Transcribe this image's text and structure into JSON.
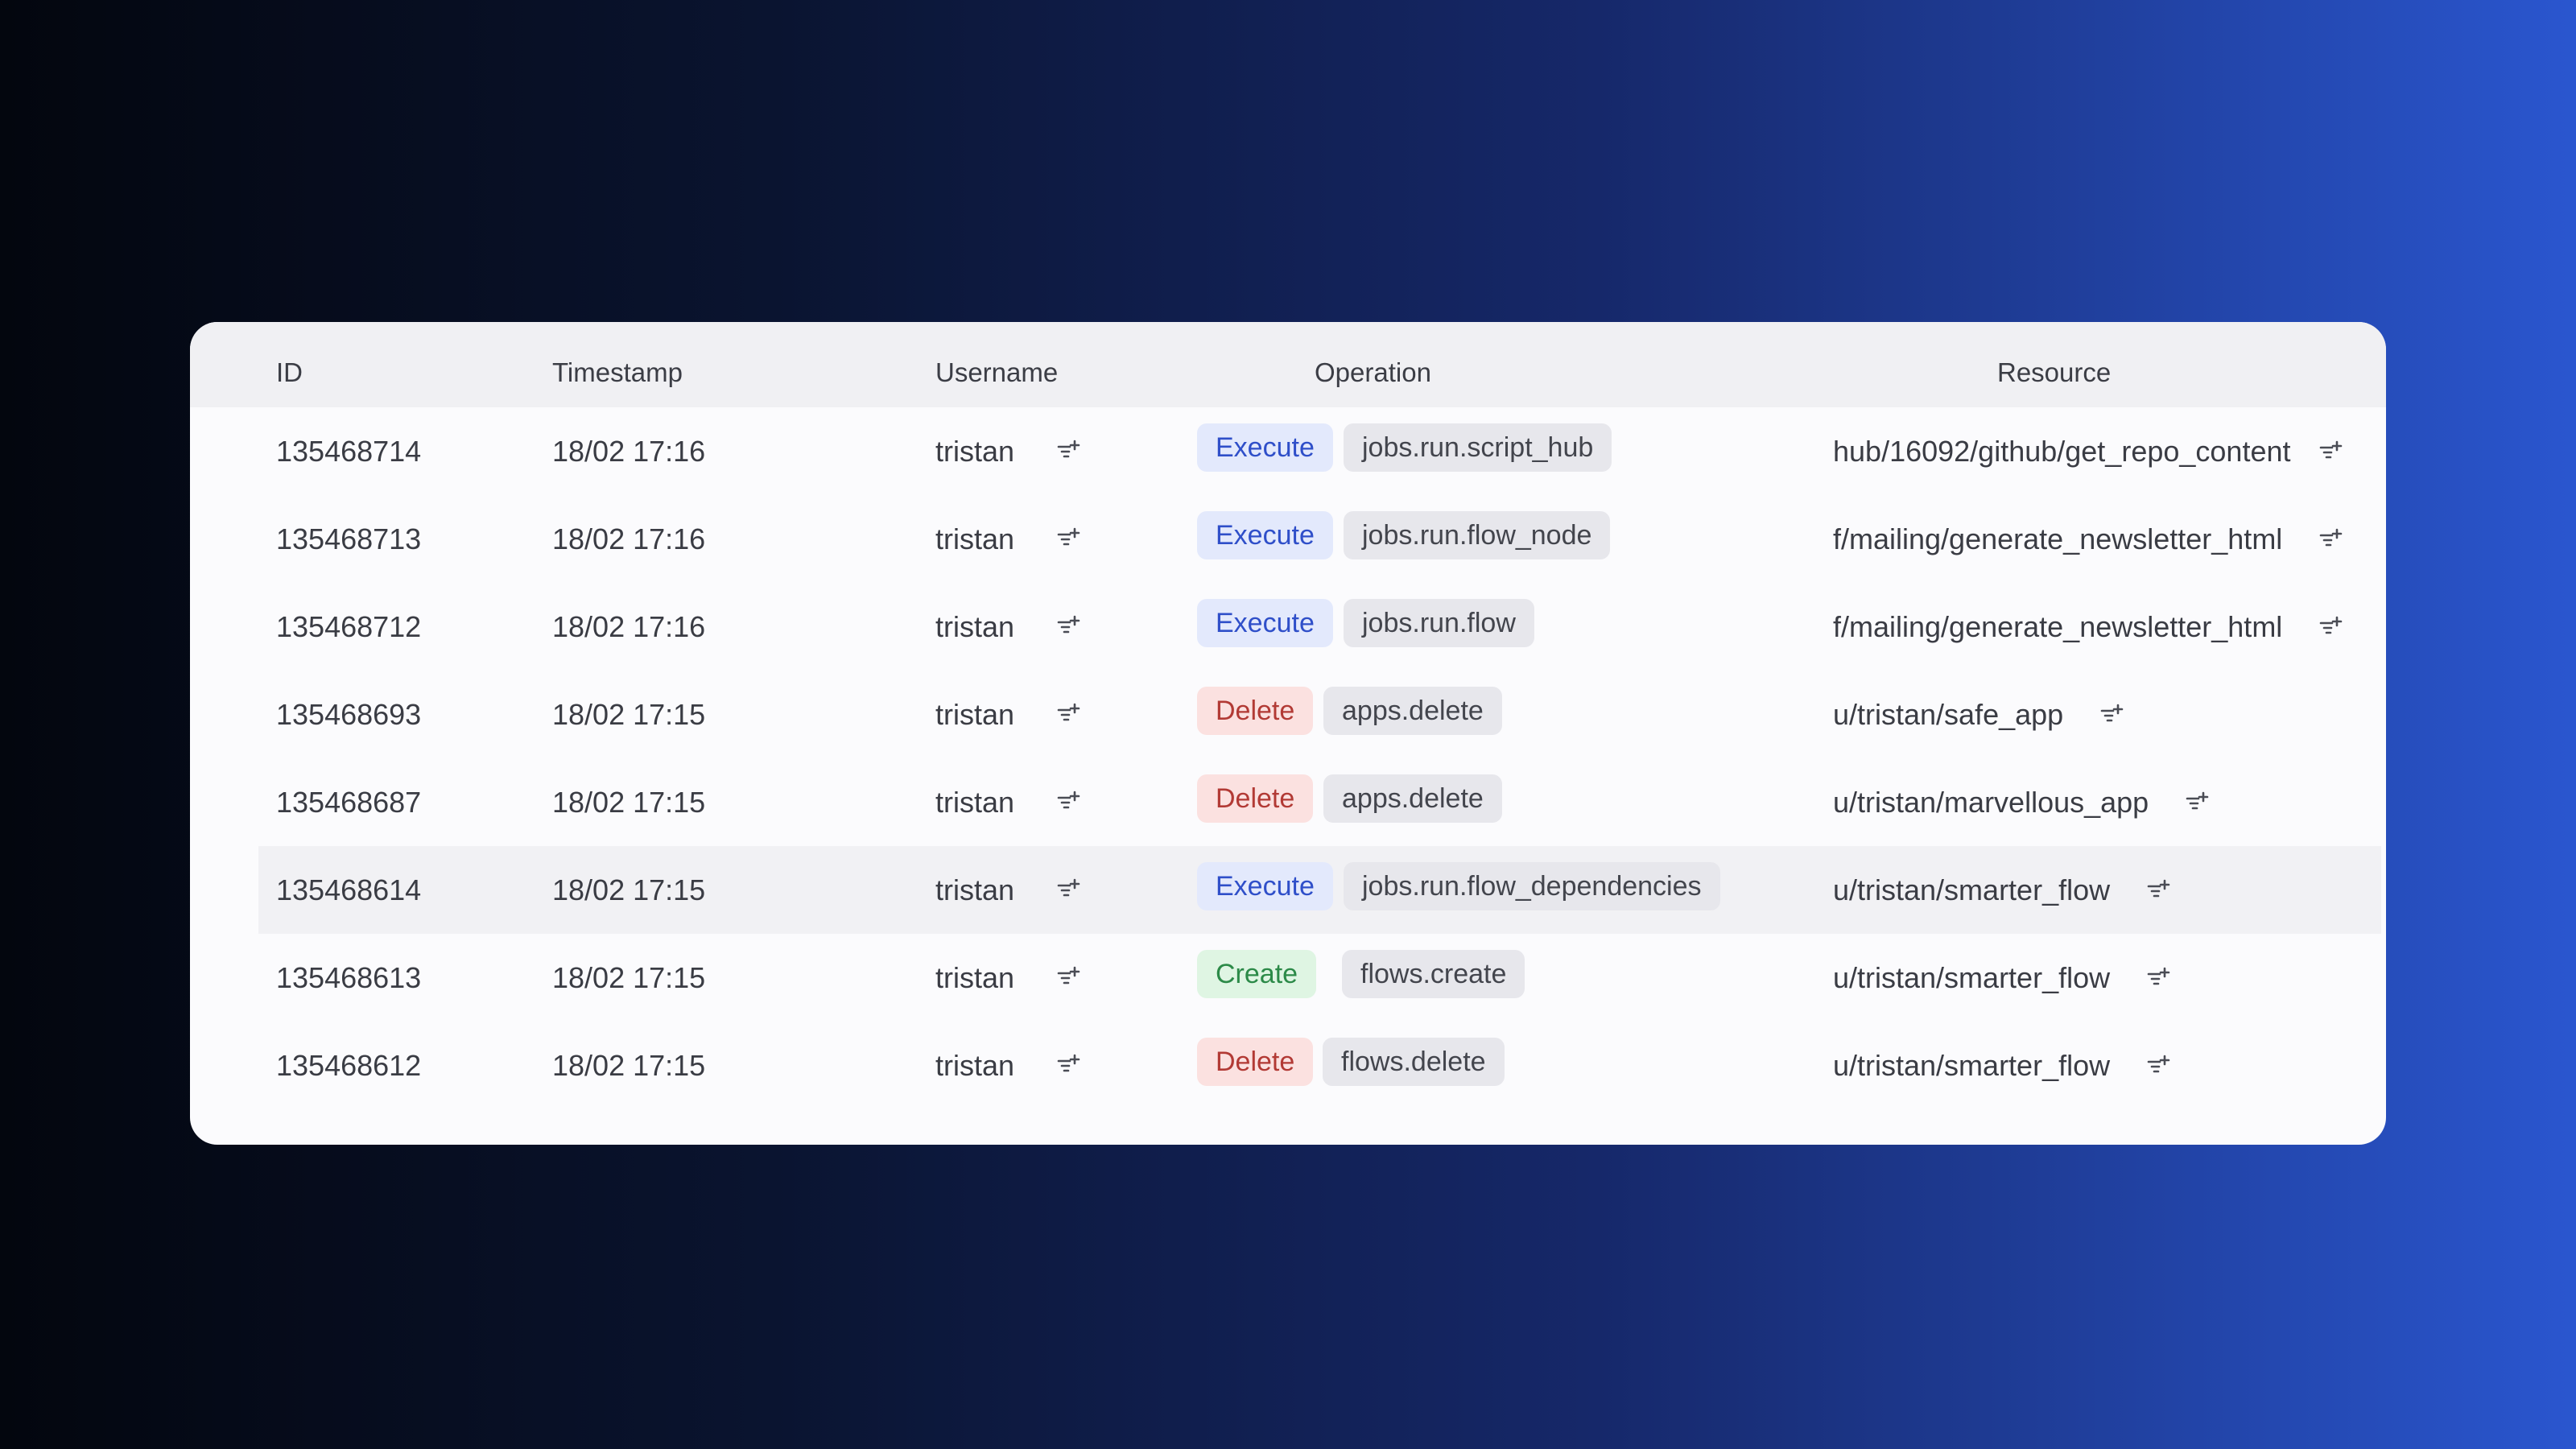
{
  "table": {
    "columns": {
      "id": "ID",
      "timestamp": "Timestamp",
      "username": "Username",
      "operation": "Operation",
      "resource": "Resource"
    },
    "rows": [
      {
        "id": "135468714",
        "timestamp": "18/02 17:16",
        "username": "tristan",
        "kind": "Execute",
        "kind_type": "execute",
        "op": "jobs.run.script_hub",
        "resource": "hub/16092/github/get_repo_content",
        "highlighted": false
      },
      {
        "id": "135468713",
        "timestamp": "18/02 17:16",
        "username": "tristan",
        "kind": "Execute",
        "kind_type": "execute",
        "op": "jobs.run.flow_node",
        "resource": "f/mailing/generate_newsletter_html",
        "highlighted": false
      },
      {
        "id": "135468712",
        "timestamp": "18/02 17:16",
        "username": "tristan",
        "kind": "Execute",
        "kind_type": "execute",
        "op": "jobs.run.flow",
        "resource": "f/mailing/generate_newsletter_html",
        "highlighted": false
      },
      {
        "id": "135468693",
        "timestamp": "18/02 17:15",
        "username": "tristan",
        "kind": "Delete",
        "kind_type": "delete",
        "op": "apps.delete",
        "resource": "u/tristan/safe_app",
        "highlighted": false
      },
      {
        "id": "135468687",
        "timestamp": "18/02 17:15",
        "username": "tristan",
        "kind": "Delete",
        "kind_type": "delete",
        "op": "apps.delete",
        "resource": "u/tristan/marvellous_app",
        "highlighted": false
      },
      {
        "id": "135468614",
        "timestamp": "18/02 17:15",
        "username": "tristan",
        "kind": "Execute",
        "kind_type": "execute",
        "op": "jobs.run.flow_dependencies",
        "resource": "u/tristan/smarter_flow",
        "highlighted": true
      },
      {
        "id": "135468613",
        "timestamp": "18/02 17:15",
        "username": "tristan",
        "kind": "Create",
        "kind_type": "create",
        "op": "flows.create",
        "resource": "u/tristan/smarter_flow",
        "highlighted": false
      },
      {
        "id": "135468612",
        "timestamp": "18/02 17:15",
        "username": "tristan",
        "kind": "Delete",
        "kind_type": "delete",
        "op": "flows.delete",
        "resource": "u/tristan/smarter_flow",
        "highlighted": false
      }
    ]
  },
  "icons": {
    "filter": "filter-plus-icon"
  },
  "colors": {
    "execute_badge_bg": "#e3e9fc",
    "execute_badge_text": "#2f4fc9",
    "delete_badge_bg": "#fbe1e0",
    "delete_badge_text": "#b23a35",
    "create_badge_bg": "#dff5e3",
    "create_badge_text": "#2c8a48",
    "operation_badge_bg": "#e7e7ec"
  }
}
